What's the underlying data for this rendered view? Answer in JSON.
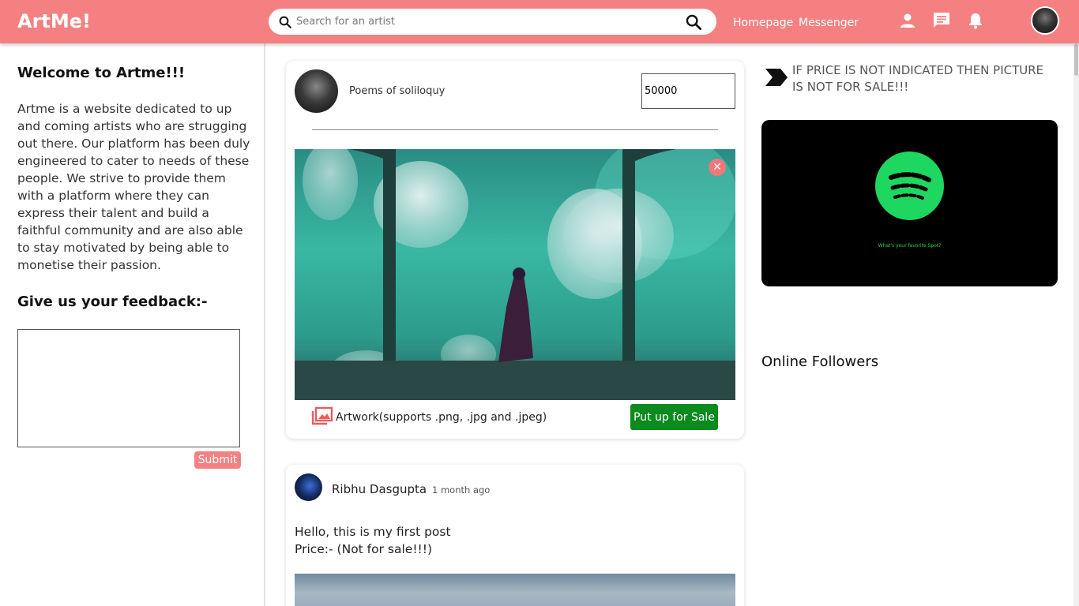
{
  "header": {
    "logo": "ArtMe!",
    "search_placeholder": "Search for an artist",
    "nav": {
      "homepage": "Homepage",
      "messenger": "Messenger"
    },
    "icons": [
      "person-icon",
      "chat-icon",
      "bell-icon"
    ]
  },
  "sidebar": {
    "welcome_title": "Welcome to Artme!!!",
    "welcome_text": "Artme is a website dedicated to up and coming artists who are strugging out there. Our platform has been duly engineered to cater to needs of these people. We strive to provide them with a platform where they can express their talent and build a faithful community and are also able to stay motivated by being able to monetise their passion.",
    "feedback_title": "Give us your feedback:-",
    "feedback_value": "",
    "submit_label": "Submit"
  },
  "composer": {
    "author": "Poems of soliloquy",
    "price_value": "50000",
    "close_glyph": "✕",
    "upload_label": "Artwork(supports .png, .jpg and .jpeg)",
    "sale_button": "Put up for Sale"
  },
  "post": {
    "author": "Ribhu Dasgupta",
    "time": "1 month ago",
    "text_line1": "Hello, this is my first post",
    "text_line2": "Price:- (Not for sale!!!)"
  },
  "right": {
    "notice": "IF PRICE IS NOT INDICATED THEN PICTURE IS NOT FOR SALE!!!",
    "ad_caption": "What's your favorite Spot?",
    "followers_title": "Online Followers"
  },
  "colors": {
    "brand": "#f58082",
    "sale_button": "#0b8a1e",
    "spotify": "#1ed760"
  }
}
